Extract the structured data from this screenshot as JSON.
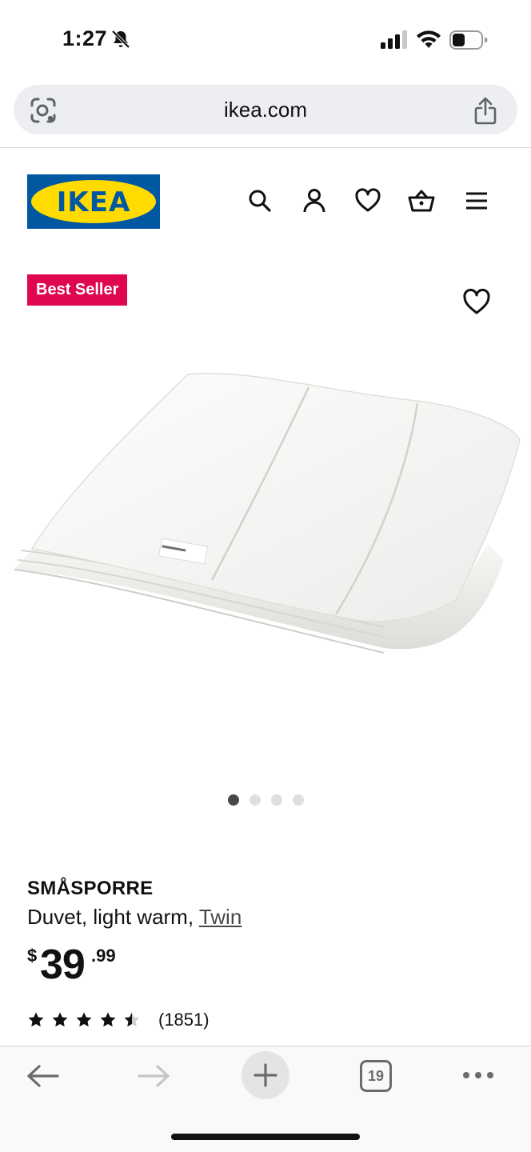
{
  "status_bar": {
    "time": "1:27"
  },
  "browser": {
    "url": "ikea.com",
    "tab_count": "19"
  },
  "brand": {
    "logo_text": "IKEA",
    "colors": {
      "blue": "#0058a3",
      "yellow": "#ffdb00",
      "badge": "#e00751"
    }
  },
  "header_icons": [
    "search-icon",
    "account-icon",
    "heart-icon",
    "basket-icon",
    "menu-icon"
  ],
  "product": {
    "badge": "Best Seller",
    "name": "SMÅSPORRE",
    "description": "Duvet, light warm, ",
    "size": "Twin",
    "price": {
      "currency": "$",
      "integer": "39",
      "decimal": ".99"
    },
    "rating": {
      "stars": 4.5,
      "max": 5,
      "count": "(1851)"
    },
    "image_dots": {
      "total": 4,
      "active": 0
    }
  }
}
